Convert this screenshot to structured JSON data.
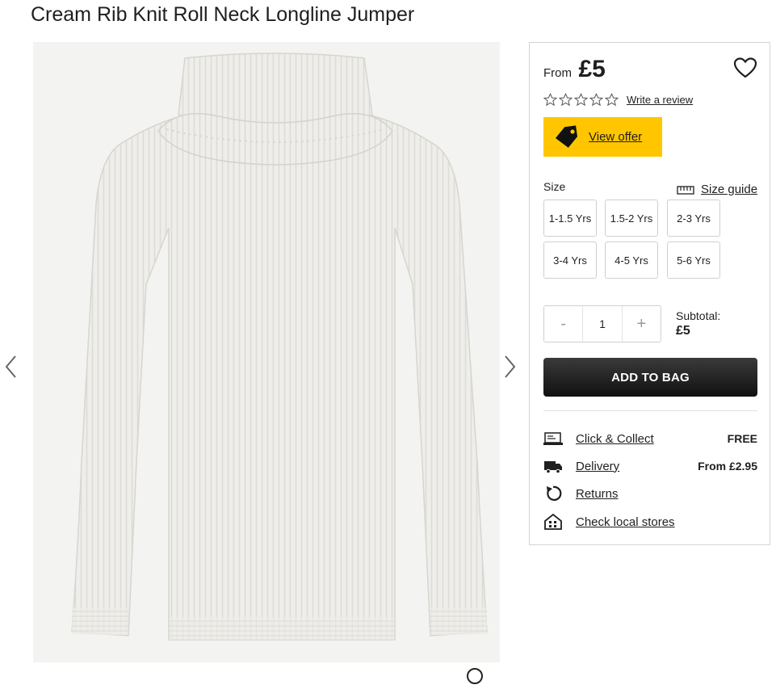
{
  "product": {
    "title": "Cream Rib Knit Roll Neck Longline Jumper"
  },
  "gallery": {
    "prev_icon": "chevron-left-icon",
    "next_icon": "chevron-right-icon",
    "zoom_icon": "zoom-icon"
  },
  "pricing": {
    "from_label": "From",
    "price": "£5"
  },
  "reviews": {
    "rating": 0,
    "max_rating": 5,
    "write_review_label": "Write a review"
  },
  "offer": {
    "label": "View offer",
    "color": "#ffc600"
  },
  "sizes": {
    "label": "Size",
    "guide_label": "Size guide",
    "options": [
      "1-1.5 Yrs",
      "1.5-2 Yrs",
      "2-3 Yrs",
      "3-4 Yrs",
      "4-5 Yrs",
      "5-6 Yrs"
    ]
  },
  "quantity": {
    "minus": "-",
    "value": "1",
    "plus": "+"
  },
  "subtotal": {
    "label": "Subtotal:",
    "value": "£5"
  },
  "add_to_bag": {
    "label": "ADD TO BAG"
  },
  "services": [
    {
      "icon": "click-collect-icon",
      "label": "Click & Collect",
      "value": "FREE"
    },
    {
      "icon": "delivery-truck-icon",
      "label": "Delivery",
      "value": "From £2.95"
    },
    {
      "icon": "returns-icon",
      "label": "Returns",
      "value": ""
    },
    {
      "icon": "store-icon",
      "label": "Check local stores",
      "value": ""
    }
  ]
}
